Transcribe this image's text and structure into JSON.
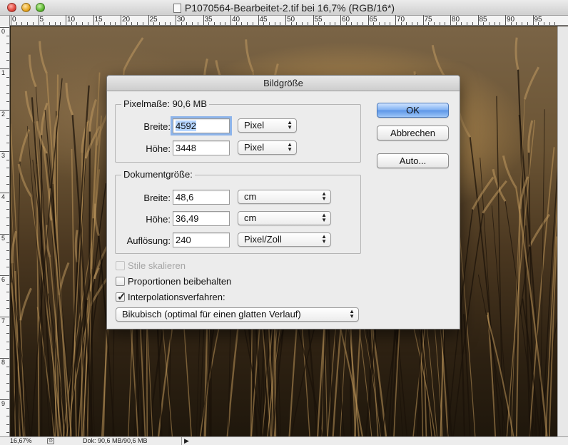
{
  "window": {
    "title": "P1070564-Bearbeitet-2.tif bei 16,7% (RGB/16*)"
  },
  "ruler": {
    "top_labels": [
      "0",
      "5",
      "10",
      "15",
      "20",
      "25",
      "30",
      "35",
      "40",
      "45",
      "50",
      "55",
      "60",
      "65",
      "70",
      "75",
      "80",
      "85",
      "90",
      "95"
    ],
    "left_labels": [
      "0",
      "1",
      "2",
      "3",
      "4",
      "5",
      "6",
      "7",
      "8",
      "9"
    ]
  },
  "status": {
    "zoom": "16,67%",
    "doc_size": "Dok: 90,6 MB/90,6 MB"
  },
  "dialog": {
    "title": "Bildgröße",
    "pixel_group": {
      "label": "Pixelmaße: 90,6 MB",
      "width_label": "Breite:",
      "width_value": "4592",
      "width_unit": "Pixel",
      "height_label": "Höhe:",
      "height_value": "3448",
      "height_unit": "Pixel"
    },
    "doc_group": {
      "label": "Dokumentgröße:",
      "width_label": "Breite:",
      "width_value": "48,6",
      "width_unit": "cm",
      "height_label": "Höhe:",
      "height_value": "36,49",
      "height_unit": "cm",
      "resolution_label": "Auflösung:",
      "resolution_value": "240",
      "resolution_unit": "Pixel/Zoll"
    },
    "checkboxes": {
      "scale_styles": {
        "label": "Stile skalieren",
        "checked": false,
        "enabled": false
      },
      "constrain": {
        "label": "Proportionen beibehalten",
        "checked": false,
        "enabled": true
      },
      "resample": {
        "label": "Interpolationsverfahren:",
        "checked": true,
        "enabled": true
      }
    },
    "resample_method": "Bikubisch (optimal für einen glatten Verlauf)",
    "buttons": {
      "ok": "OK",
      "cancel": "Abbrechen",
      "auto": "Auto..."
    }
  },
  "colors": {
    "default_button": "#5b95e6",
    "focus_ring": "#8db4ea",
    "selection": "#b5d5ff"
  }
}
